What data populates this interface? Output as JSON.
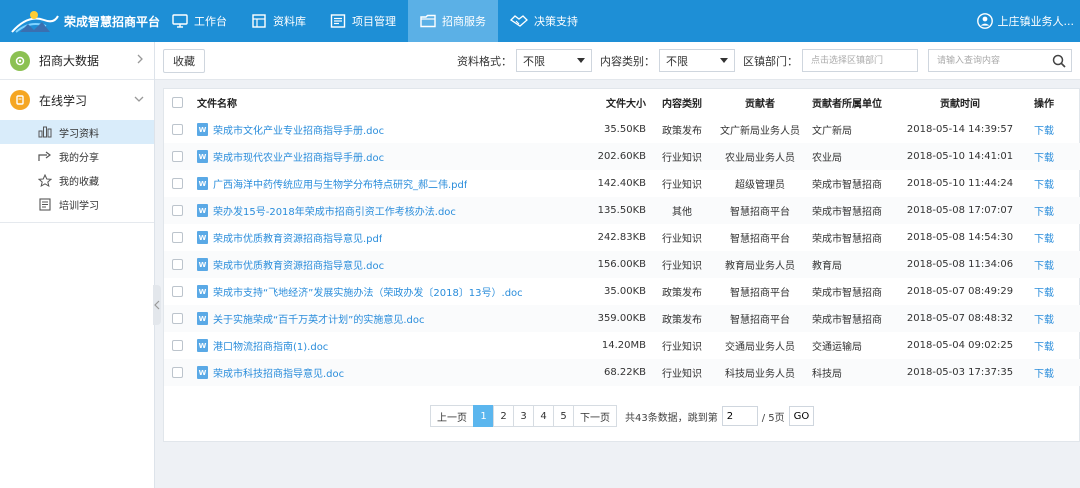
{
  "app": {
    "title": "荣成智慧招商平台",
    "user": "上庄镇业务人..."
  },
  "nav": [
    {
      "label": "工作台",
      "icon": "monitor-icon",
      "active": false
    },
    {
      "label": "资料库",
      "icon": "database-icon",
      "active": false
    },
    {
      "label": "项目管理",
      "icon": "project-icon",
      "active": false
    },
    {
      "label": "招商服务",
      "icon": "folder-icon",
      "active": true
    },
    {
      "label": "决策支持",
      "icon": "handshake-icon",
      "active": false
    }
  ],
  "sidebar": {
    "groups": [
      {
        "label": "招商大数据",
        "icon": "bigdata-icon",
        "color": "#8cc152",
        "expanded": false
      },
      {
        "label": "在线学习",
        "icon": "study-icon",
        "color": "#f5a623",
        "expanded": true
      }
    ],
    "items": [
      {
        "label": "学习资料",
        "icon": "chart-icon",
        "active": true
      },
      {
        "label": "我的分享",
        "icon": "share-icon",
        "active": false
      },
      {
        "label": "我的收藏",
        "icon": "star-icon",
        "active": false
      },
      {
        "label": "培训学习",
        "icon": "document-icon",
        "active": false
      }
    ]
  },
  "toolbar": {
    "favorite_label": "收藏",
    "format_label": "资料格式：",
    "format_value": "不限",
    "category_label": "内容类别：",
    "category_value": "不限",
    "dept_label": "区镇部门：",
    "dept_placeholder": "点击选择区镇部门",
    "search_placeholder": "请输入查询内容"
  },
  "table": {
    "headers": {
      "name": "文件名称",
      "size": "文件大小",
      "type": "内容类别",
      "contributor": "贡献者",
      "unit": "贡献者所属单位",
      "time": "贡献时间",
      "op": "操作"
    },
    "download_label": "下载",
    "rows": [
      {
        "name": "荣成市文化产业专业招商指导手册.doc",
        "size": "35.50KB",
        "type": "政策发布",
        "contributor": "文广新局业务人员",
        "unit": "文广新局",
        "time": "2018-05-14 14:39:57"
      },
      {
        "name": "荣成市现代农业产业招商指导手册.doc",
        "size": "202.60KB",
        "type": "行业知识",
        "contributor": "农业局业务人员",
        "unit": "农业局",
        "time": "2018-05-10 14:41:01"
      },
      {
        "name": "广西海洋中药传统应用与生物学分布特点研究_郝二伟.pdf",
        "size": "142.40KB",
        "type": "行业知识",
        "contributor": "超级管理员",
        "unit": "荣成市智慧招商",
        "time": "2018-05-10 11:44:24"
      },
      {
        "name": "荣办发15号-2018年荣成市招商引资工作考核办法.doc",
        "size": "135.50KB",
        "type": "其他",
        "contributor": "智慧招商平台",
        "unit": "荣成市智慧招商",
        "time": "2018-05-08 17:07:07"
      },
      {
        "name": "荣成市优质教育资源招商指导意见.pdf",
        "size": "242.83KB",
        "type": "行业知识",
        "contributor": "智慧招商平台",
        "unit": "荣成市智慧招商",
        "time": "2018-05-08 14:54:30"
      },
      {
        "name": "荣成市优质教育资源招商指导意见.doc",
        "size": "156.00KB",
        "type": "行业知识",
        "contributor": "教育局业务人员",
        "unit": "教育局",
        "time": "2018-05-08 11:34:06"
      },
      {
        "name": "荣成市支持“飞地经济”发展实施办法（荣政办发〔2018〕13号）.doc",
        "size": "35.00KB",
        "type": "政策发布",
        "contributor": "智慧招商平台",
        "unit": "荣成市智慧招商",
        "time": "2018-05-07 08:49:29"
      },
      {
        "name": "关于实施荣成“百千万英才计划”的实施意见.doc",
        "size": "359.00KB",
        "type": "政策发布",
        "contributor": "智慧招商平台",
        "unit": "荣成市智慧招商",
        "time": "2018-05-07 08:48:32"
      },
      {
        "name": "港口物流招商指南(1).doc",
        "size": "14.20MB",
        "type": "行业知识",
        "contributor": "交通局业务人员",
        "unit": "交通运输局",
        "time": "2018-05-04 09:02:25"
      },
      {
        "name": "荣成市科技招商指导意见.doc",
        "size": "68.22KB",
        "type": "行业知识",
        "contributor": "科技局业务人员",
        "unit": "科技局",
        "time": "2018-05-03 17:37:35"
      }
    ]
  },
  "pagination": {
    "prev_label": "上一页",
    "next_label": "下一页",
    "pages": [
      "1",
      "2",
      "3",
      "4",
      "5"
    ],
    "current_page": "1",
    "info": "共43条数据，跳到第",
    "jump_value": "2",
    "total": "/ 5页",
    "go_label": "GO"
  }
}
